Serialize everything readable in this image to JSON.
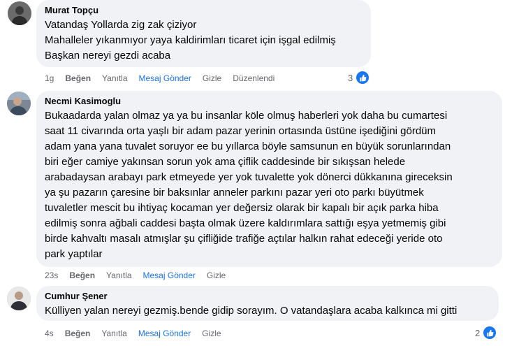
{
  "comments": [
    {
      "author": "Murat Topçu",
      "lines": [
        "Vatandaş Yollarda zig zak çiziyor",
        "Mahalleler yıkanmıyor yaya kaldirimları ticaret için işgal edilmiş",
        "Başkan nereyi gezdi acaba"
      ],
      "time": "1g",
      "like": "Beğen",
      "reply": "Yanıtla",
      "message": "Mesaj Gönder",
      "hide": "Gizle",
      "edited": "Düzenlendi",
      "reaction_count": "3"
    },
    {
      "author": "Necmi Kasimoglu",
      "lines": [
        "Bukaadarda yalan olmaz ya ya bu insanlar köle olmuş haberleri yok daha bu cumartesi",
        "saat 11 civarında orta yaşlı bir adam pazar yerinin ortasında üstüne işediğini gördüm",
        "adam yana yana tuvalet soruyor ee bu yıllarca böyle samsunun en büyük sorunlarından",
        "biri eğer camiye yakınsan sorun yok ama çiflik caddesinde bir sıkışsan helede",
        "arabadaysan arabayı park etmeyede yer yok tuvalette yok dönerci dükkanına gireceksin",
        "ya şu pazarın çaresine bir baksınlar anneler parkını pazar yeri oto parkı büyütmek",
        "tuvaletler mescit bu ihtiyaç kocaman yer değersiz olarak bir kapalı bir açık parka hiba",
        "edilmiş sonra ağbali caddesi başta olmak üzere kaldırımlara sattığı eşya yetmemiş gibi",
        "birde kahvaltı masalı atmışlar şu çifliğide trafiğe açtılar halkın rahat edeceği yeride oto",
        "park yaptılar"
      ],
      "time": "23s",
      "like": "Beğen",
      "reply": "Yanıtla",
      "message": "Mesaj Gönder",
      "hide": "Gizle"
    },
    {
      "author": "Cumhur Şener",
      "lines": [
        "Külliyen yalan nereyi gezmiş.bende gidip sorayım. O vatandaşlara acaba kalkınca mi gitti"
      ],
      "time": "4s",
      "like": "Beğen",
      "reply": "Yanıtla",
      "message": "Mesaj Gönder",
      "hide": "Gizle",
      "reaction_count": "2"
    }
  ],
  "colors": {
    "bubble": "#f0f2f5",
    "link_blue": "#1b74e4",
    "secondary_text": "#65676b",
    "like_blue": "#1877f2"
  },
  "icons": {
    "avatar": "user-avatar-photo",
    "reaction": "thumbs-up-icon"
  }
}
